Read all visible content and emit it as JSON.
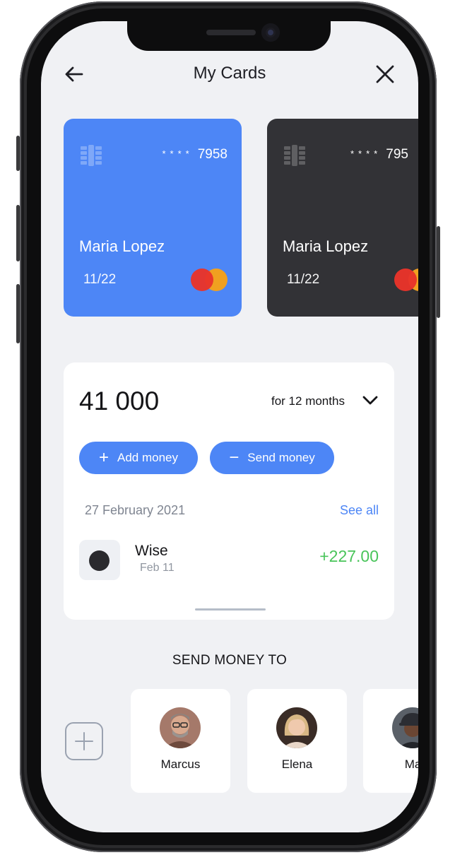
{
  "header": {
    "title": "My Cards",
    "back_icon": "arrow-left-icon",
    "close_icon": "close-icon"
  },
  "cards": [
    {
      "stars": "****",
      "last4": "7958",
      "holder": "Maria Lopez",
      "expiry": "11/22",
      "color": "#4d86f6",
      "brand_icon": "mastercard-icon"
    },
    {
      "stars": "****",
      "last4": "795",
      "holder": "Maria Lopez",
      "expiry": "11/22",
      "color": "#323236",
      "brand_icon": "mastercard-icon"
    }
  ],
  "balance": {
    "amount": "41 000",
    "period": "for 12 months",
    "add_label": "Add money",
    "send_label": "Send money"
  },
  "transactions": {
    "date": "27 February 2021",
    "see_all": "See all",
    "items": [
      {
        "name": "Wise",
        "date": "Feb 11",
        "amount": "+227.00"
      }
    ]
  },
  "send_to": {
    "title": "SEND MONEY TO",
    "contacts": [
      {
        "name": "Marcus"
      },
      {
        "name": "Elena"
      },
      {
        "name": "Ma"
      }
    ]
  },
  "colors": {
    "accent": "#4d86f6",
    "positive": "#49c45a",
    "background": "#f0f1f4"
  }
}
